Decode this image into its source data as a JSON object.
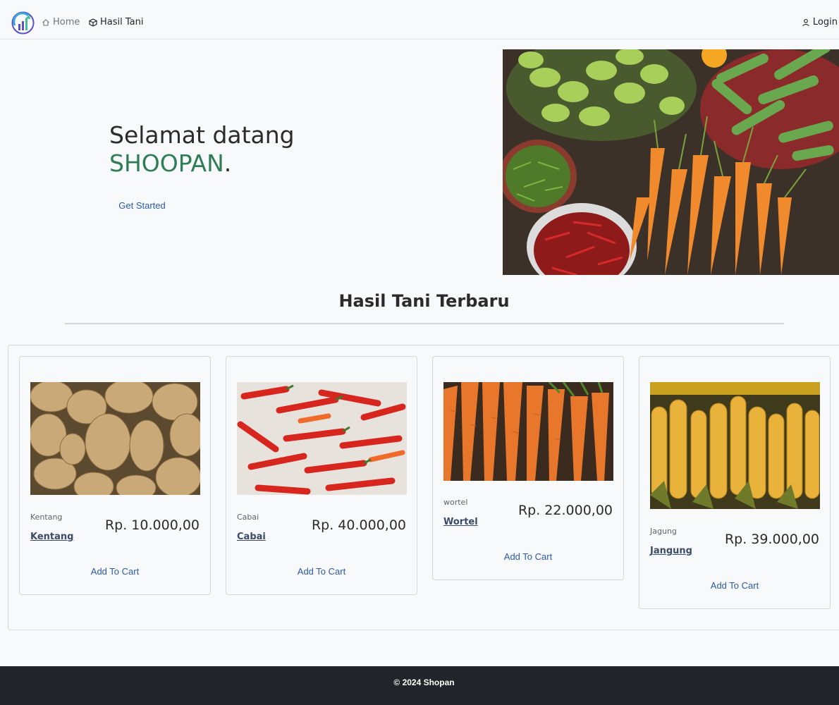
{
  "nav": {
    "home_label": "Home",
    "hasil_tani_label": "Hasil Tani",
    "login_label": "Login"
  },
  "hero": {
    "greeting": "Selamat datang",
    "brand": "SHOOPAN",
    "brand_punct": ".",
    "cta_label": "Get Started",
    "image_subject": "vegetables at market: bitter gourd, cucumbers, chili peppers, carrots"
  },
  "section": {
    "title": "Hasil Tani Terbaru"
  },
  "products": [
    {
      "category": "Kentang",
      "name": "Kentang",
      "price": "Rp. 10.000,00",
      "button": "Add To Cart",
      "image_subject": "potatoes"
    },
    {
      "category": "Cabai",
      "name": "Cabai",
      "price": "Rp. 40.000,00",
      "button": "Add To Cart",
      "image_subject": "red chili peppers"
    },
    {
      "category": "wortel",
      "name": "Wortel",
      "price": "Rp. 22.000,00",
      "button": "Add To Cart",
      "image_subject": "carrots"
    },
    {
      "category": "Jagung",
      "name": "Jangung",
      "price": "Rp. 39.000,00",
      "button": "Add To Cart",
      "image_subject": "corn cobs"
    }
  ],
  "footer": {
    "copyright": "© 2024 Shopan"
  },
  "colors": {
    "brand_green": "#2e7d57",
    "link_blue": "#2b5aa8",
    "footer_bg": "#212529",
    "page_bg": "#f8f9fa"
  }
}
